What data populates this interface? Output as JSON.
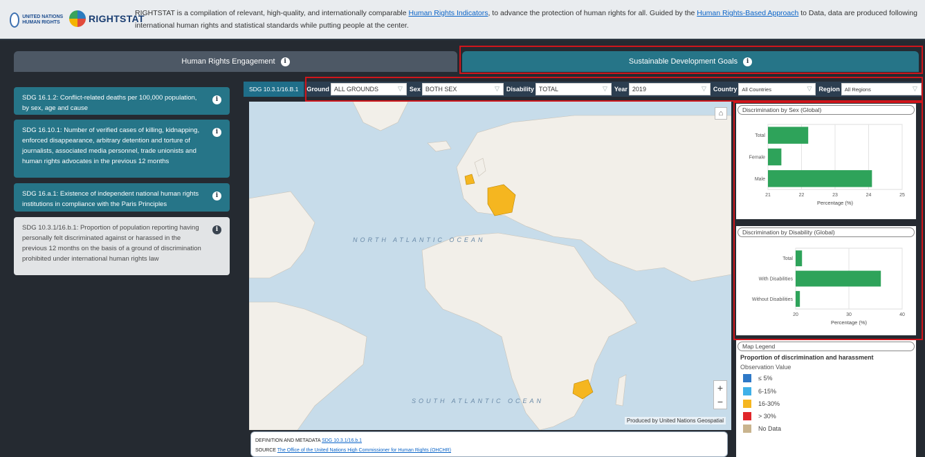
{
  "header": {
    "logo_un_text": "UNITED NATIONS HUMAN RIGHTS",
    "logo_app_text": "RIGHTSTAT",
    "desc_pre": "RIGHTSTAT is a compilation of relevant, high-quality, and internationally comparable ",
    "link1": "Human Rights Indicators",
    "desc_mid": ", to advance the protection of human rights for all. Guided by the ",
    "link2": "Human Rights-Based Approach",
    "desc_post": " to Data, data are produced following international human rights and statistical standards while putting people at the center."
  },
  "tabs": [
    {
      "label": "Human Rights Engagement"
    },
    {
      "label": "Sustainable Development Goals"
    }
  ],
  "sidebar": [
    {
      "label": "SDG 16.1.2: Conflict-related deaths per 100,000 population, by sex, age and cause",
      "active": false
    },
    {
      "label": "SDG 16.10.1: Number of verified cases of killing, kidnapping, enforced disappearance, arbitrary detention and torture of journalists, associated media personnel, trade unionists and human rights advocates in the previous 12 months",
      "active": false
    },
    {
      "label": "SDG 16.a.1: Existence of independent national human rights institutions in compliance with the Paris Principles",
      "active": false
    },
    {
      "label": "SDG 10.3.1/16.b.1: Proportion of population reporting having personally felt discriminated against or harassed in the previous 12 months on the basis of a ground of discrimination prohibited under international human rights law",
      "active": true
    }
  ],
  "filters": {
    "code": "SDG 10.3.1/16.B.1",
    "ground_label": "Ground",
    "ground_value": "ALL GROUNDS",
    "sex_label": "Sex",
    "sex_value": "BOTH SEX",
    "disability_label": "Disability",
    "disability_value": "TOTAL",
    "year_label": "Year",
    "year_value": "2019",
    "country_label": "Country",
    "country_value": "All Countries",
    "region_label": "Region",
    "region_value": "All Regions"
  },
  "map": {
    "oceans": [
      "NORTH ATLANTIC OCEAN",
      "SOUTH ATLANTIC OCEAN"
    ],
    "attribution": "Produced by United Nations Geospatial",
    "zoom_in": "+",
    "zoom_out": "−",
    "highlighted_color": "#f5b620",
    "land_color": "#f2efe9",
    "water_color": "#c7dcea"
  },
  "meta": {
    "def_label": "DEFINITION AND METADATA",
    "def_link": "SDG 10.3.1/16.b.1",
    "source_label": "SOURCE",
    "source_link": "The Office of the United Nations High Commissioner for Human Rights (OHCHR)"
  },
  "chart_data": [
    {
      "type": "bar",
      "orientation": "horizontal",
      "title": "Discrimination by Sex (Global)",
      "categories": [
        "Total",
        "Female",
        "Male"
      ],
      "values": [
        22.2,
        21.4,
        24.1
      ],
      "xlabel": "Percentage (%)",
      "xlim": [
        21,
        25
      ],
      "xticks": [
        21,
        22,
        23,
        24,
        25
      ],
      "color": "#2ea35a"
    },
    {
      "type": "bar",
      "orientation": "horizontal",
      "title": "Discrimination by Disability (Global)",
      "categories": [
        "Total",
        "With Disabilities",
        "Without Disabilities"
      ],
      "values": [
        21.2,
        36.0,
        20.8
      ],
      "xlabel": "Percentage (%)",
      "xlim": [
        20,
        40
      ],
      "xticks": [
        20,
        30,
        40
      ],
      "color": "#2ea35a"
    }
  ],
  "legend": {
    "title": "Map Legend",
    "heading": "Proportion of discrimination and harassment",
    "subheading": "Observation Value",
    "items": [
      {
        "label": "≤ 5%",
        "color": "#2e78c7"
      },
      {
        "label": "6-15%",
        "color": "#3fb0e8"
      },
      {
        "label": "16-30%",
        "color": "#f5b620"
      },
      {
        "label": "> 30%",
        "color": "#e0262a"
      },
      {
        "label": "No Data",
        "color": "#c9b48e"
      }
    ]
  }
}
